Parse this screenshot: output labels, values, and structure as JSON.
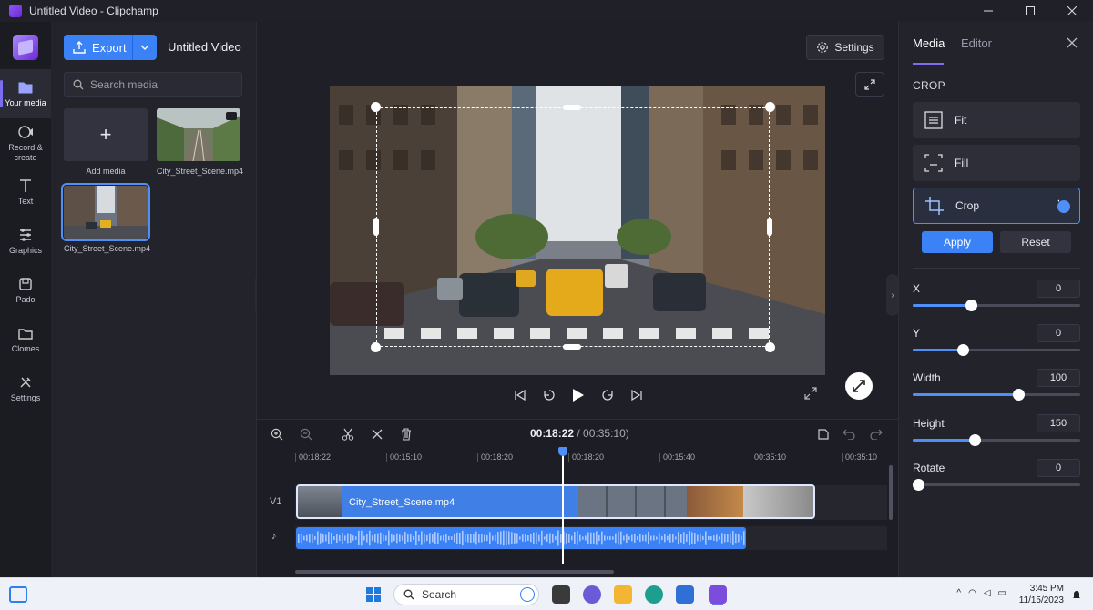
{
  "window": {
    "title": "Untitled Video - Clipchamp"
  },
  "rail": {
    "items": [
      {
        "label": "Your media",
        "icon": "folder-icon"
      },
      {
        "label": "Record & create",
        "icon": "record-icon"
      },
      {
        "label": "Text",
        "icon": "text-icon"
      },
      {
        "label": "Graphics",
        "icon": "graphics-icon"
      },
      {
        "label": "Pado",
        "icon": "pado-icon"
      },
      {
        "label": "Clomes",
        "icon": "clomes-icon"
      },
      {
        "label": "Settings",
        "icon": "settings-icon"
      }
    ]
  },
  "media_panel": {
    "export_label": "Export",
    "project_title": "Untitled Video",
    "search_placeholder": "Search media",
    "add_media_label": "Add media",
    "items": [
      {
        "name": "City_Street_Scene.mp4"
      },
      {
        "name": "City_Street_Scene.mp4"
      }
    ]
  },
  "preview": {
    "settings_label": "Settings"
  },
  "timeline": {
    "current_time": "00:18:22",
    "total_time": "/ 00:35:10)",
    "ruler": [
      "00:18:22",
      "00:15:10",
      "00:18:20",
      "00:18:20",
      "00:15:40",
      "00:35:10",
      "00:35:10"
    ],
    "video_track_label": "V1",
    "clip_name": "City_Street_Scene.mp4"
  },
  "right_panel": {
    "tabs": [
      "Media",
      "Editor"
    ],
    "section": "CROP",
    "options": [
      {
        "label": "Fit",
        "selected": false
      },
      {
        "label": "Fill",
        "selected": false
      },
      {
        "label": "Crop",
        "selected": true
      }
    ],
    "apply_label": "Apply",
    "reset_label": "Reset",
    "sliders": [
      {
        "label": "X",
        "value": "0",
        "fraction": 0.35
      },
      {
        "label": "Y",
        "value": "0",
        "fraction": 0.3
      },
      {
        "label": "Width",
        "value": "100",
        "fraction": 0.63
      },
      {
        "label": "Height",
        "value": "150",
        "fraction": 0.37
      },
      {
        "label": "Rotate",
        "value": "0",
        "fraction": 0.03
      }
    ]
  },
  "taskbar": {
    "search_label": "Search",
    "time": "3:45 PM",
    "date": "11/15/2023"
  },
  "colors": {
    "accent": "#3b82f6",
    "selection": "#4f8ff7",
    "brand": "#7c6cf0"
  }
}
